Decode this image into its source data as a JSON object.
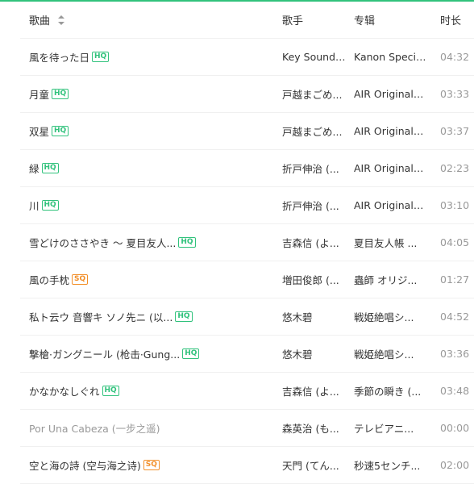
{
  "header": {
    "col_song": "歌曲",
    "col_artist": "歌手",
    "col_album": "专辑",
    "col_duration": "时长"
  },
  "colors": {
    "accent": "#31c27c",
    "hq_badge": "#31c27c",
    "sq_badge": "#f28f29"
  },
  "songs": [
    {
      "title": "風を待った日",
      "badge": "HQ",
      "artist": "Key Sounds...",
      "album": "Kanon Special...",
      "duration": "04:32"
    },
    {
      "title": "月童",
      "badge": "HQ",
      "artist": "戸越まごめ...",
      "album": "AIR Original S...",
      "duration": "03:33"
    },
    {
      "title": "双星",
      "badge": "HQ",
      "artist": "戸越まごめ...",
      "album": "AIR Original S...",
      "duration": "03:37"
    },
    {
      "title": "緑",
      "badge": "HQ",
      "artist": "折戸伸治 (...",
      "album": "AIR Original S...",
      "duration": "02:23"
    },
    {
      "title": "川",
      "badge": "HQ",
      "artist": "折戸伸治 (...",
      "album": "AIR Original S...",
      "duration": "03:10"
    },
    {
      "title": "雪どけのささやき 〜 夏目友人...",
      "badge": "HQ",
      "artist": "吉森信 (よ...",
      "album": "夏目友人帳 ...",
      "duration": "04:05"
    },
    {
      "title": "風の手枕",
      "badge": "SQ",
      "artist": "増田俊郎 (...",
      "album": "蟲師 オリジ...",
      "duration": "01:27"
    },
    {
      "title": "私ト云ウ 音響キ ソノ先ニ (以...",
      "badge": "HQ",
      "artist": "悠木碧",
      "album": "戦姫絶唱シ...",
      "duration": "04:52"
    },
    {
      "title": "撃槍·ガングニール (枪击·Gung...",
      "badge": "HQ",
      "artist": "悠木碧",
      "album": "戦姫絶唱シ...",
      "duration": "03:36"
    },
    {
      "title": "かなかなしぐれ",
      "badge": "HQ",
      "artist": "吉森信 (よ...",
      "album": "季節の瞬き (...",
      "duration": "03:48"
    },
    {
      "title": "Por Una Cabeza (一步之遥)",
      "badge": "",
      "artist": "森英治 (も...",
      "album": "テレビアニ...",
      "duration": "00:00"
    },
    {
      "title": "空と海の詩 (空与海之诗)",
      "badge": "SQ",
      "artist": "天門 (てん...",
      "album": "秒速5センチ...",
      "duration": "02:00"
    }
  ]
}
